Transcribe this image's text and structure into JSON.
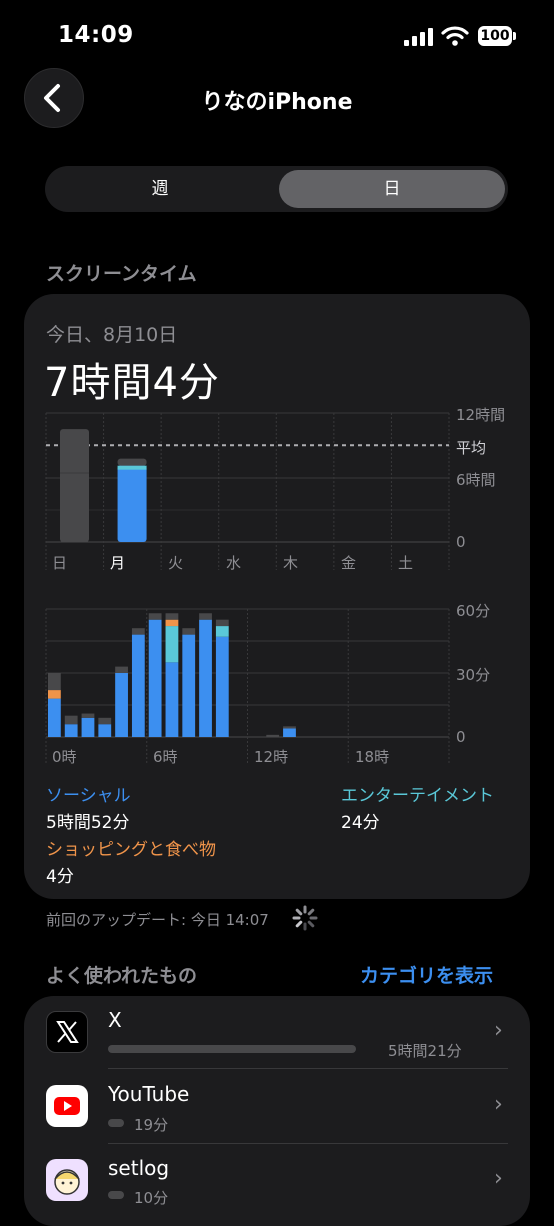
{
  "status": {
    "time": "14:09",
    "battery": "100"
  },
  "header": {
    "title": "りなのiPhone"
  },
  "segment": {
    "week": "週",
    "day": "日"
  },
  "screen_time": {
    "section_title": "スクリーンタイム",
    "date": "今日、8月10日",
    "total": "7時間4分"
  },
  "week_chart": {
    "days": [
      "日",
      "月",
      "火",
      "水",
      "木",
      "金",
      "土"
    ],
    "y_labels": [
      "12時間",
      "平均",
      "6時間",
      "0"
    ],
    "hours": [
      10.5,
      7.1,
      0,
      0,
      0,
      0,
      0
    ],
    "average_hours": 9
  },
  "chart_data": {
    "type": "bar",
    "x_labels": [
      "0時",
      "6時",
      "12時",
      "18時"
    ],
    "y_labels": [
      "60分",
      "30分",
      "0"
    ],
    "ylim": [
      0,
      60
    ],
    "hours": [
      0,
      1,
      2,
      3,
      4,
      5,
      6,
      7,
      8,
      9,
      10,
      11,
      12,
      13,
      14,
      15,
      16,
      17,
      18,
      19,
      20,
      21,
      22,
      23
    ],
    "series": [
      {
        "name": "ソーシャル",
        "color": "#3c8ff0",
        "values": [
          18,
          6,
          9,
          6,
          30,
          48,
          55,
          35,
          48,
          55,
          47,
          0,
          0,
          0,
          4,
          0,
          0,
          0,
          0,
          0,
          0,
          0,
          0,
          0
        ]
      },
      {
        "name": "エンターテイメント",
        "color": "#5ac8d8",
        "values": [
          0,
          0,
          0,
          0,
          0,
          0,
          0,
          17,
          0,
          0,
          5,
          0,
          0,
          0,
          0,
          0,
          0,
          0,
          0,
          0,
          0,
          0,
          0,
          0
        ]
      },
      {
        "name": "ショッピングと食べ物",
        "color": "#f0944a",
        "values": [
          4,
          0,
          0,
          0,
          0,
          0,
          0,
          3,
          0,
          0,
          0,
          0,
          0,
          0,
          0,
          0,
          0,
          0,
          0,
          0,
          0,
          0,
          0,
          0
        ]
      },
      {
        "values": [
          8,
          4,
          2,
          3,
          3,
          3,
          3,
          3,
          3,
          3,
          3,
          0,
          0,
          1,
          1,
          0,
          0,
          0,
          0,
          0,
          0,
          0,
          0,
          0
        ],
        "color": "#48484a"
      }
    ]
  },
  "categories": [
    {
      "name": "ソーシャル",
      "value": "5時間52分",
      "color": "#3c8ff0"
    },
    {
      "name": "エンターテイメント",
      "value": "24分",
      "color": "#5ac8d8"
    },
    {
      "name": "ショッピングと食べ物",
      "value": "4分",
      "color": "#f0944a"
    }
  ],
  "update": {
    "text": "前回のアップデート: 今日 14:07"
  },
  "most_used": {
    "title": "よく使われたもの",
    "show_categories": "カテゴリを表示",
    "apps": [
      {
        "name": "X",
        "time": "5時間21分",
        "usage_fraction": 0.91
      },
      {
        "name": "YouTube",
        "time": "19分",
        "usage_fraction": 0.05
      },
      {
        "name": "setlog",
        "time": "10分",
        "usage_fraction": 0.04
      }
    ]
  }
}
